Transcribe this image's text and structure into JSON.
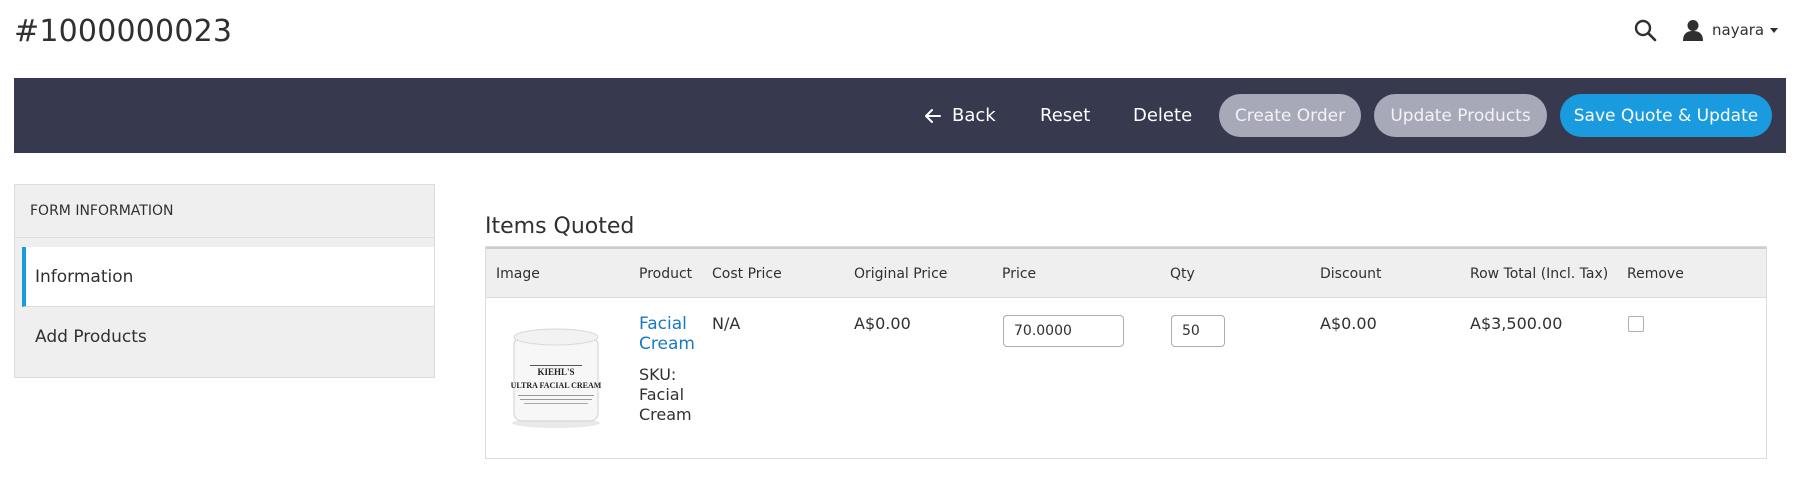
{
  "header": {
    "title": "#1000000023",
    "username": "nayara"
  },
  "actions": {
    "back": "Back",
    "reset": "Reset",
    "delete": "Delete",
    "create_order": "Create Order",
    "update_products": "Update Products",
    "save": "Save Quote & Update"
  },
  "sidebar": {
    "heading": "FORM INFORMATION",
    "items": [
      {
        "label": "Information",
        "active": true
      },
      {
        "label": "Add Products",
        "active": false
      }
    ]
  },
  "items_quoted": {
    "title": "Items Quoted",
    "columns": [
      "Image",
      "Product",
      "Cost Price",
      "Original Price",
      "Price",
      "Qty",
      "Discount",
      "Row Total (Incl. Tax)",
      "Remove"
    ],
    "rows": [
      {
        "product_name": "Facial Cream",
        "sku_label": "SKU: Facial Cream",
        "image_text": [
          "KIEHL'S",
          "ULTRA FACIAL CREAM"
        ],
        "cost_price": "N/A",
        "original_price": "A$0.00",
        "price": "70.0000",
        "qty": "50",
        "discount": "A$0.00",
        "row_total": "A$3,500.00",
        "remove": false
      }
    ]
  },
  "colors": {
    "action_bar": "#373a4e",
    "primary": "#1a9be0",
    "disabled": "#a7a9b9",
    "link": "#1979c3"
  }
}
